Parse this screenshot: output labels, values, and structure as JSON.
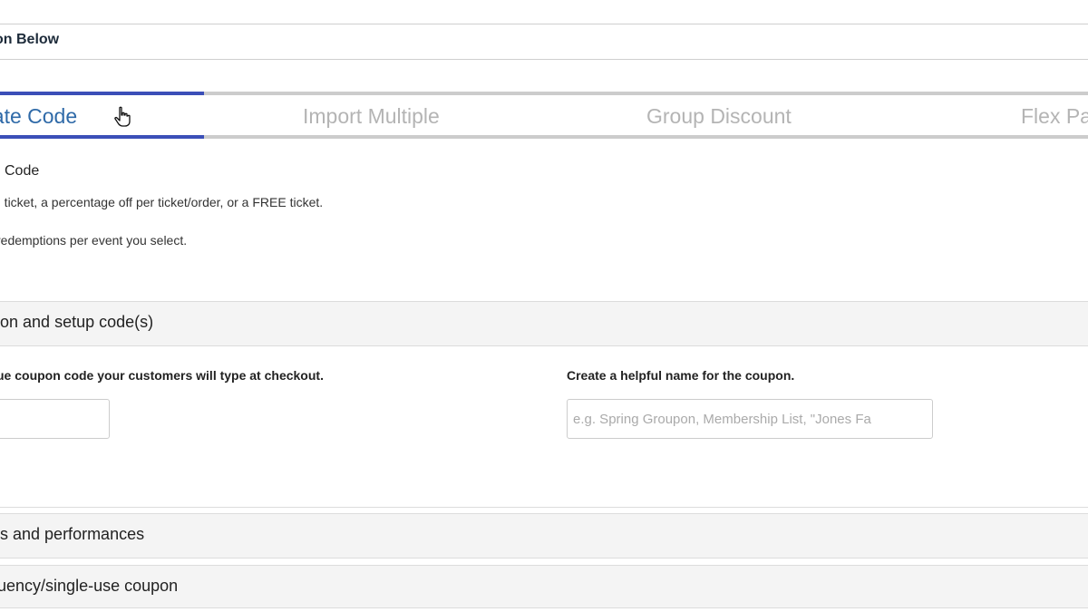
{
  "section": {
    "title": "on Below"
  },
  "tabs": [
    {
      "label": "eate Code",
      "active": true
    },
    {
      "label": "Import Multiple",
      "active": false
    },
    {
      "label": "Group Discount",
      "active": false
    },
    {
      "label": "Flex Pa",
      "active": false
    }
  ],
  "intro": {
    "heading": "Code",
    "line1": "ch ticket, a percentage off per ticket/order, or a FREE ticket.",
    "line2": "redemptions per event you select."
  },
  "panels": {
    "setup": {
      "label": "pon and setup code(s)"
    },
    "events": {
      "label": "nts and performances"
    },
    "frequency": {
      "label": "quency/single-use coupon"
    }
  },
  "form": {
    "code_label": "ue coupon code your customers will type at checkout.",
    "code_value": "",
    "name_label": "Create a helpful name for the coupon.",
    "name_placeholder": "e.g. Spring Groupon, Membership List, \"Jones Fa"
  },
  "colors": {
    "active_tab_border": "#3b4fb8",
    "active_tab_text": "#2f6aa8",
    "inactive_tab_text": "#b4b4b4",
    "panel_bg": "#f4f4f4"
  },
  "icons": {
    "cursor": "hand-pointer-icon"
  }
}
